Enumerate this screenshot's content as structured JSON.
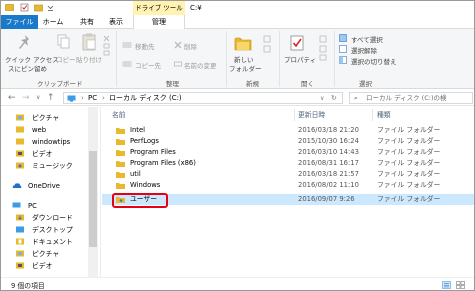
{
  "window": {
    "tools_tab": "ドライブ ツール",
    "title": "C:¥"
  },
  "tabs": [
    "ファイル",
    "ホーム",
    "共有",
    "表示",
    "管理"
  ],
  "ribbon": {
    "clipboard": {
      "quick_access": "クイック アクセス",
      "pin": "スにピン留め",
      "copy": "コピー",
      "paste": "貼り付け",
      "label": "クリップボード"
    },
    "organize": {
      "move_to": "移動先",
      "copy_to": "コピー先",
      "delete": "削除",
      "rename": "名前の変更",
      "label": "整理"
    },
    "new": {
      "new_folder_1": "新しい",
      "new_folder_2": "フォルダー",
      "label": "新規"
    },
    "open": {
      "properties": "プロパティ",
      "label": "開く"
    },
    "select": {
      "select_all": "すべて選択",
      "select_none": "選択解除",
      "invert": "選択の切り替え",
      "label": "選択"
    }
  },
  "address": {
    "crumbs": [
      "PC",
      "ローカル ディスク (C:)"
    ],
    "search_placeholder": "ローカル ディスク (C:)の検"
  },
  "navpane": {
    "items": [
      {
        "label": "ピクチャ",
        "icon": "pictures-folder-icon"
      },
      {
        "label": "web",
        "icon": "folder-icon"
      },
      {
        "label": "windowtips",
        "icon": "folder-icon"
      },
      {
        "label": "ビデオ",
        "icon": "videos-folder-icon"
      },
      {
        "label": "ミュージック",
        "icon": "music-folder-icon"
      },
      {
        "label": "OneDrive",
        "icon": "onedrive-icon"
      },
      {
        "label": "PC",
        "icon": "pc-icon"
      },
      {
        "label": "ダウンロード",
        "icon": "downloads-folder-icon"
      },
      {
        "label": "デスクトップ",
        "icon": "desktop-folder-icon"
      },
      {
        "label": "ドキュメント",
        "icon": "documents-folder-icon"
      },
      {
        "label": "ピクチャ",
        "icon": "pictures-folder-icon"
      },
      {
        "label": "ビデオ",
        "icon": "videos-folder-icon"
      }
    ]
  },
  "columns": {
    "name": "名前",
    "modified": "更新日時",
    "type": "種類"
  },
  "files": [
    {
      "name": "Intel",
      "modified": "2016/03/18 21:20",
      "type": "ファイル フォルダー"
    },
    {
      "name": "PerfLogs",
      "modified": "2015/10/30 16:24",
      "type": "ファイル フォルダー"
    },
    {
      "name": "Program Files",
      "modified": "2016/03/10 14:43",
      "type": "ファイル フォルダー"
    },
    {
      "name": "Program Files (x86)",
      "modified": "2016/08/31 16:17",
      "type": "ファイル フォルダー"
    },
    {
      "name": "util",
      "modified": "2016/03/18 21:57",
      "type": "ファイル フォルダー"
    },
    {
      "name": "Windows",
      "modified": "2016/08/02 11:10",
      "type": "ファイル フォルダー"
    },
    {
      "name": "ユーザー",
      "modified": "2016/09/07 9:26",
      "type": "ファイル フォルダー"
    }
  ],
  "status": {
    "count": "9 個の項目"
  },
  "colors": {
    "accent": "#1979ca",
    "folder": "#e8b92c",
    "selection": "#cce8ff",
    "highlight": "#e60012"
  }
}
